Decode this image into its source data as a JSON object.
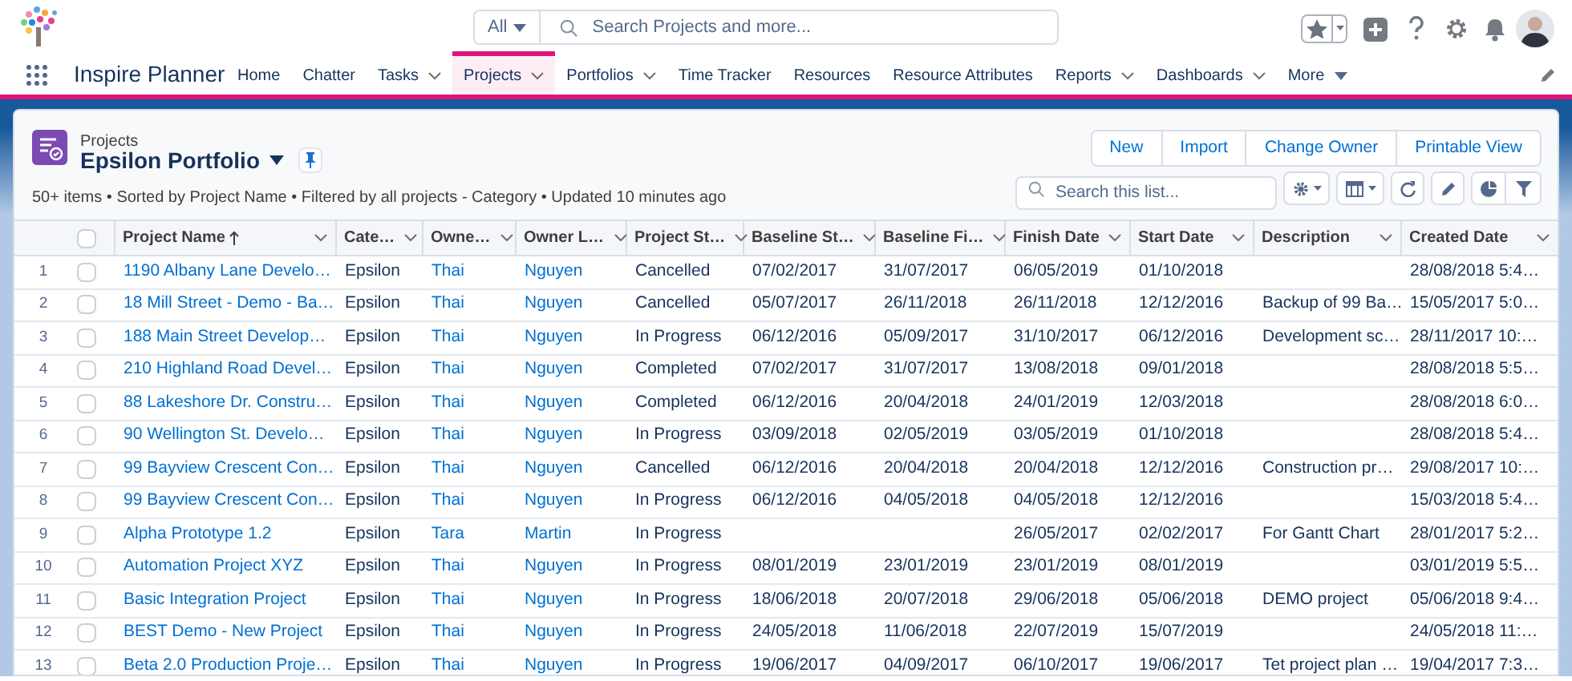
{
  "header": {
    "search_scope": "All",
    "search_placeholder": "Search Projects and more..."
  },
  "nav": {
    "app_name": "Inspire Planner",
    "items": [
      {
        "label": "Home",
        "selected": false,
        "kind": "plain"
      },
      {
        "label": "Chatter",
        "selected": false,
        "kind": "plain"
      },
      {
        "label": "Tasks",
        "selected": false,
        "kind": "menu"
      },
      {
        "label": "Projects",
        "selected": true,
        "kind": "menu"
      },
      {
        "label": "Portfolios",
        "selected": false,
        "kind": "menu"
      },
      {
        "label": "Time Tracker",
        "selected": false,
        "kind": "plain"
      },
      {
        "label": "Resources",
        "selected": false,
        "kind": "plain"
      },
      {
        "label": "Resource Attributes",
        "selected": false,
        "kind": "plain"
      },
      {
        "label": "Reports",
        "selected": false,
        "kind": "menu"
      },
      {
        "label": "Dashboards",
        "selected": false,
        "kind": "menu"
      },
      {
        "label": "More",
        "selected": false,
        "kind": "more"
      }
    ]
  },
  "list_view": {
    "object": "Projects",
    "title": "Epsilon Portfolio",
    "summary": "50+ items • Sorted by Project Name • Filtered by all projects - Category • Updated 10 minutes ago",
    "buttons": [
      "New",
      "Import",
      "Change Owner",
      "Printable View"
    ],
    "search_placeholder": "Search this list..."
  },
  "table": {
    "all_selected": false,
    "columns": [
      {
        "label": "Project Name",
        "kind": "link",
        "sorted": true
      },
      {
        "label": "Cate…",
        "kind": "text",
        "sorted": false
      },
      {
        "label": "Owne…",
        "kind": "link",
        "sorted": false
      },
      {
        "label": "Owner L…",
        "kind": "link",
        "sorted": false
      },
      {
        "label": "Project St…",
        "kind": "text",
        "sorted": false
      },
      {
        "label": "Baseline St…",
        "kind": "text",
        "sorted": false
      },
      {
        "label": "Baseline Fi…",
        "kind": "text",
        "sorted": false
      },
      {
        "label": "Finish Date",
        "kind": "text",
        "sorted": false
      },
      {
        "label": "Start Date",
        "kind": "text",
        "sorted": false
      },
      {
        "label": "Description",
        "kind": "text",
        "sorted": false
      },
      {
        "label": "Created Date",
        "kind": "text",
        "sorted": false
      }
    ],
    "rows": [
      {
        "number": "1",
        "selected": false,
        "cells": [
          "1190 Albany Lane Develo…",
          "Epsilon",
          "Thai",
          "Nguyen",
          "Cancelled",
          "07/02/2017",
          "31/07/2017",
          "06/05/2019",
          "01/10/2018",
          "",
          "28/08/2018 5:4…"
        ]
      },
      {
        "number": "2",
        "selected": false,
        "cells": [
          "18 Mill Street - Demo - Ba…",
          "Epsilon",
          "Thai",
          "Nguyen",
          "Cancelled",
          "05/07/2017",
          "26/11/2018",
          "26/11/2018",
          "12/12/2016",
          "Backup of 99 Ba…",
          "15/05/2017 5:0…"
        ]
      },
      {
        "number": "3",
        "selected": false,
        "cells": [
          "188 Main Street Develop…",
          "Epsilon",
          "Thai",
          "Nguyen",
          "In Progress",
          "06/12/2016",
          "05/09/2017",
          "31/10/2017",
          "06/12/2016",
          "Development sc…",
          "28/11/2017 10:…"
        ]
      },
      {
        "number": "4",
        "selected": false,
        "cells": [
          "210 Highland Road Devel…",
          "Epsilon",
          "Thai",
          "Nguyen",
          "Completed",
          "07/02/2017",
          "31/07/2017",
          "13/08/2018",
          "09/01/2018",
          "",
          "28/08/2018 5:5…"
        ]
      },
      {
        "number": "5",
        "selected": false,
        "cells": [
          "88 Lakeshore Dr. Constru…",
          "Epsilon",
          "Thai",
          "Nguyen",
          "Completed",
          "06/12/2016",
          "20/04/2018",
          "24/01/2019",
          "12/03/2018",
          "",
          "28/08/2018 6:0…"
        ]
      },
      {
        "number": "6",
        "selected": false,
        "cells": [
          "90 Wellington St. Develo…",
          "Epsilon",
          "Thai",
          "Nguyen",
          "In Progress",
          "03/09/2018",
          "02/05/2019",
          "03/05/2019",
          "01/10/2018",
          "",
          "28/08/2018 5:4…"
        ]
      },
      {
        "number": "7",
        "selected": false,
        "cells": [
          "99 Bayview Crescent Con…",
          "Epsilon",
          "Thai",
          "Nguyen",
          "Cancelled",
          "06/12/2016",
          "20/04/2018",
          "20/04/2018",
          "12/12/2016",
          "Construction pr…",
          "29/08/2017 10:…"
        ]
      },
      {
        "number": "8",
        "selected": false,
        "cells": [
          "99 Bayview Crescent Con…",
          "Epsilon",
          "Thai",
          "Nguyen",
          "In Progress",
          "06/12/2016",
          "04/05/2018",
          "04/05/2018",
          "12/12/2016",
          "",
          "15/03/2018 5:4…"
        ]
      },
      {
        "number": "9",
        "selected": false,
        "cells": [
          "Alpha Prototype 1.2",
          "Epsilon",
          "Tara",
          "Martin",
          "In Progress",
          "",
          "",
          "26/05/2017",
          "02/02/2017",
          "For Gantt Chart",
          "28/01/2017 5:2…"
        ]
      },
      {
        "number": "10",
        "selected": false,
        "cells": [
          "Automation Project XYZ",
          "Epsilon",
          "Thai",
          "Nguyen",
          "In Progress",
          "08/01/2019",
          "23/01/2019",
          "23/01/2019",
          "08/01/2019",
          "",
          "03/01/2019 5:5…"
        ]
      },
      {
        "number": "11",
        "selected": false,
        "cells": [
          "Basic Integration Project",
          "Epsilon",
          "Thai",
          "Nguyen",
          "In Progress",
          "18/06/2018",
          "20/07/2018",
          "29/06/2018",
          "05/06/2018",
          "DEMO project",
          "05/06/2018 9:4…"
        ]
      },
      {
        "number": "12",
        "selected": false,
        "cells": [
          "BEST Demo - New Project",
          "Epsilon",
          "Thai",
          "Nguyen",
          "In Progress",
          "24/05/2018",
          "11/06/2018",
          "22/07/2019",
          "15/07/2019",
          "",
          "24/05/2018 11:…"
        ]
      },
      {
        "number": "13",
        "selected": false,
        "cells": [
          "Beta 2.0 Production Proje…",
          "Epsilon",
          "Thai",
          "Nguyen",
          "In Progress",
          "19/06/2017",
          "04/09/2017",
          "06/10/2017",
          "19/06/2017",
          "Tet project plan …",
          "19/04/2017 7:3…"
        ]
      }
    ]
  }
}
